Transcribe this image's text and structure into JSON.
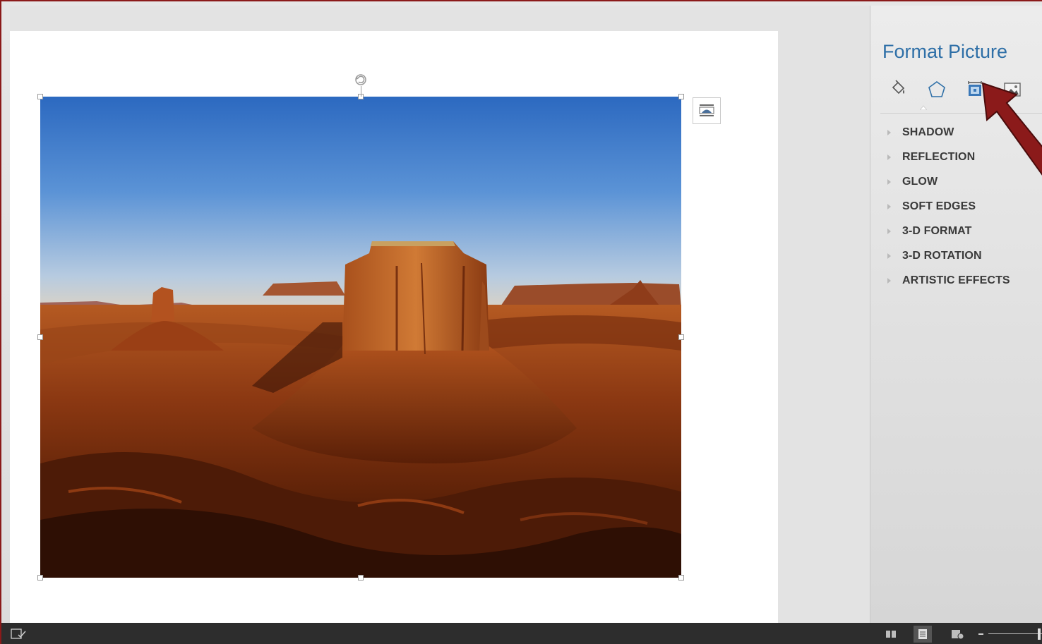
{
  "window": {
    "frame_color": "#8b1a1a"
  },
  "format_pane": {
    "title": "Format Picture",
    "title_color": "#2e6fa7",
    "tabs": [
      {
        "name": "fill-line-icon"
      },
      {
        "name": "effects-icon",
        "selected": true
      },
      {
        "name": "size-properties-icon"
      },
      {
        "name": "picture-icon"
      }
    ],
    "sections": [
      {
        "label": "SHADOW"
      },
      {
        "label": "REFLECTION"
      },
      {
        "label": "GLOW"
      },
      {
        "label": "SOFT EDGES"
      },
      {
        "label": "3-D FORMAT"
      },
      {
        "label": "3-D ROTATION"
      },
      {
        "label": "ARTISTIC EFFECTS"
      }
    ]
  },
  "document": {
    "picture": {
      "subject": "desert-butte-photo"
    }
  },
  "annotation": {
    "arrow_color": "#8b1a1a"
  },
  "statusbar": {
    "icons": [
      "proofing-icon",
      "read-mode-icon",
      "print-layout-icon",
      "web-layout-icon",
      "zoom-slider"
    ]
  }
}
